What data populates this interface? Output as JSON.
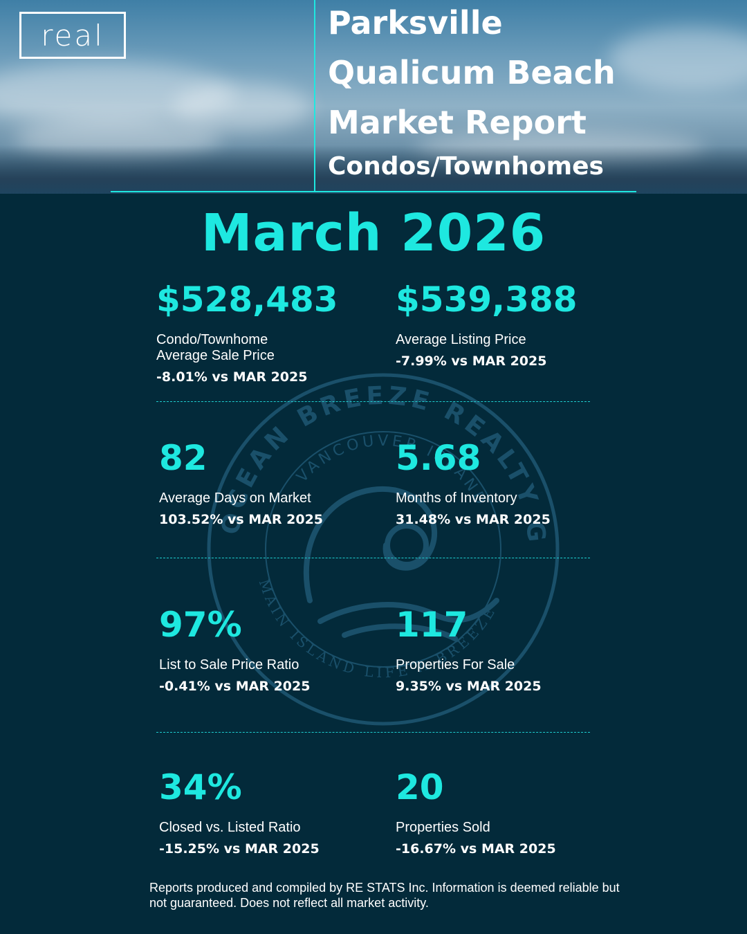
{
  "logo": {
    "text": "real"
  },
  "header": {
    "line1": "Parksville",
    "line2": "Qualicum Beach",
    "line3": "Market Report",
    "line4": "Condos/Townhomes"
  },
  "month": "March 2026",
  "stats": [
    {
      "value": "$528,483",
      "label": "Condo/Townhome\nAverage Sale Price",
      "change": "-8.01%  vs MAR 2025"
    },
    {
      "value": "$539,388",
      "label": "Average Listing Price",
      "change": "-7.99% vs MAR 2025"
    },
    {
      "value": "82",
      "label": "Average Days on Market",
      "change": "103.52%  vs MAR 2025"
    },
    {
      "value": "5.68",
      "label": "Months of Inventory",
      "change": "31.48% vs MAR 2025"
    },
    {
      "value": "97%",
      "label": "List to Sale Price Ratio",
      "change": "-0.41% vs MAR 2025"
    },
    {
      "value": "117",
      "label": "Properties For Sale",
      "change": "9.35% vs MAR 2025"
    },
    {
      "value": "34%",
      "label": "Closed vs. Listed Ratio",
      "change": "-15.25% vs MAR 2025"
    },
    {
      "value": "20",
      "label": "Properties Sold",
      "change": "-16.67% vs MAR 2025"
    }
  ],
  "seal": {
    "outer_text": "OCEAN BREEZE REALTY GROUP",
    "inner_top": "VANCOUVER ISLAND",
    "inner_bottom": "MAIN ISLAND LIFE A BREEZE"
  },
  "footer": "Reports produced and compiled by RE STATS Inc. Information is deemed reliable but not guaranteed. Does not reflect all market activity.",
  "colors": {
    "accent": "#1ee8e0",
    "background": "#032a3a"
  }
}
